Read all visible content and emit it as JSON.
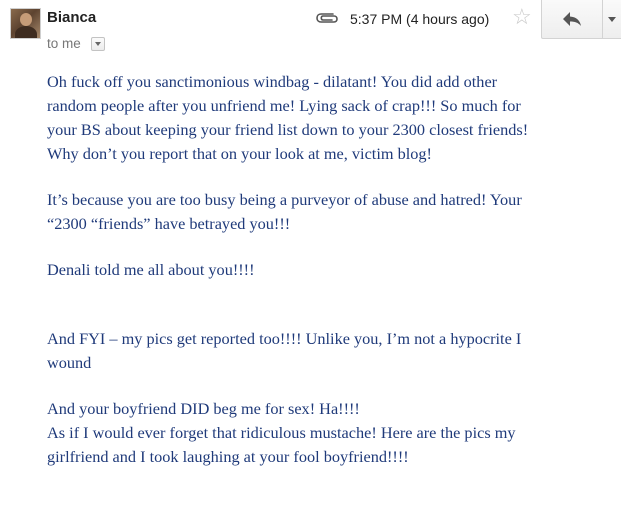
{
  "header": {
    "sender": "Bianca",
    "recipient": "to me",
    "timestamp": "5:37 PM (4 hours ago)",
    "icons": {
      "attachment": "paperclip-icon",
      "star": "star-icon",
      "reply": "reply-arrow-icon",
      "more": "chevron-down-icon"
    }
  },
  "body": {
    "lines": [
      "Oh fuck off you sanctimonious windbag - dilatant! You did add other",
      "random people after you unfriend me! Lying sack of crap!!! So much for",
      "your BS about keeping your friend list down to your 2300 closest friends!",
      "Why don’t you report that on your look at me, victim blog!",
      "It’s because  you are too busy being a purveyor of abuse and hatred! Your",
      "“2300 “friends” have betrayed you!!!",
      "Denali told me all about you!!!!",
      "And FYI – my pics get reported too!!!! Unlike you, I’m not a hypocrite I",
      "wound",
      "And your boyfriend DID beg me for sex! Ha!!!!",
      "As if I would ever forget that ridiculous mustache! Here are the pics my",
      "girlfriend and I took laughing at your fool boyfriend!!!!"
    ]
  },
  "colors": {
    "body_text": "#1f3a7a",
    "meta_text": "#777777"
  }
}
